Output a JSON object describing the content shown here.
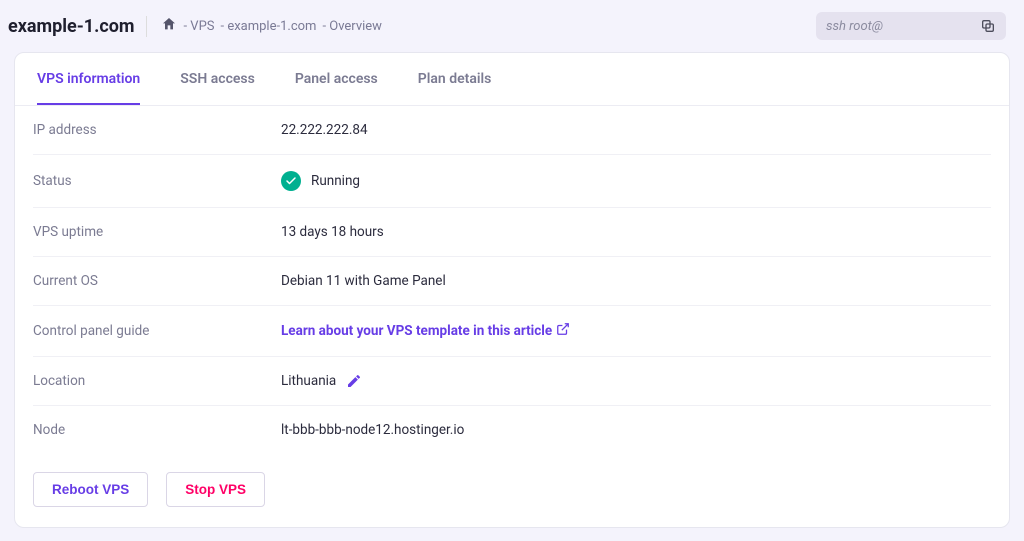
{
  "header": {
    "domain": "example-1.com",
    "breadcrumb": {
      "seg1": "- VPS",
      "seg2": "- example-1.com",
      "seg3": "- Overview"
    },
    "ssh_text": "ssh root@"
  },
  "tabs": [
    {
      "label": "VPS information"
    },
    {
      "label": "SSH access"
    },
    {
      "label": "Panel access"
    },
    {
      "label": "Plan details"
    }
  ],
  "info": {
    "ip_label": "IP address",
    "ip_value": "22.222.222.84",
    "status_label": "Status",
    "status_value": "Running",
    "uptime_label": "VPS uptime",
    "uptime_value": "13 days 18 hours",
    "os_label": "Current OS",
    "os_value": "Debian 11 with Game Panel",
    "guide_label": "Control panel guide",
    "guide_link": "Learn about your VPS template in this article",
    "location_label": "Location",
    "location_value": "Lithuania",
    "node_label": "Node",
    "node_value": "lt-bbb-bbb-node12.hostinger.io"
  },
  "actions": {
    "reboot": "Reboot VPS",
    "stop": "Stop VPS"
  }
}
